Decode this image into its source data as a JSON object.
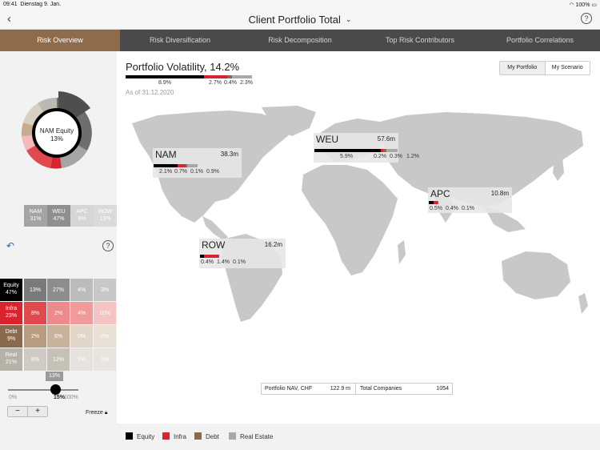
{
  "status_bar": {
    "time": "09:41",
    "date": "Dienstag 9. Jan.",
    "battery": "100%"
  },
  "header": {
    "title": "Client Portfolio Total"
  },
  "tabs": [
    {
      "label": "Risk Overview"
    },
    {
      "label": "Risk Diversification"
    },
    {
      "label": "Risk Decomposition"
    },
    {
      "label": "Top Risk Contributors"
    },
    {
      "label": "Portfolio Correlations"
    }
  ],
  "donut": {
    "center_label": "NAM Equity",
    "center_value": "13%"
  },
  "matrix": {
    "col_headers": [
      {
        "name": "NAM",
        "value": "31%"
      },
      {
        "name": "WEU",
        "value": "47%"
      },
      {
        "name": "APC",
        "value": "8%"
      },
      {
        "name": "ROW",
        "value": "13%"
      }
    ],
    "rows": [
      {
        "name": "Equity",
        "value": "47%",
        "cells": [
          "13%",
          "27%",
          "4%",
          "3%"
        ]
      },
      {
        "name": "Infra",
        "value": "23%",
        "cells": [
          "8%",
          "2%",
          "4%",
          "10%"
        ]
      },
      {
        "name": "Debt",
        "value": "9%",
        "cells": [
          "2%",
          "6%",
          "0%",
          "0%"
        ]
      },
      {
        "name": "Real",
        "value": "21%",
        "cells": [
          "8%",
          "12%",
          "1%",
          "1%"
        ]
      }
    ]
  },
  "slider": {
    "bubble": "13%",
    "min_label": "0%",
    "value_label": "15%",
    "max_label": "100%",
    "value_fraction": 0.15
  },
  "stepper": {
    "minus": "−",
    "plus": "+"
  },
  "freeze": {
    "label": "Freeze"
  },
  "portfolio": {
    "title": "Portfolio Volatility, 14.2%",
    "as_of": "As of 31.12.2020",
    "breakdown": [
      "8.9%",
      "2.7%",
      "0.4%",
      "2.3%"
    ]
  },
  "toggle": {
    "my_portfolio": "My Portfolio",
    "my_scenario": "My Scenario"
  },
  "regions": [
    {
      "name": "NAM",
      "value": "38.3m",
      "breakdown": [
        "2.1%",
        "0.7%",
        "0.1%",
        "0.9%"
      ]
    },
    {
      "name": "WEU",
      "value": "57.6m",
      "breakdown": [
        "5.9%",
        "0.2%",
        "0.3%",
        "1.2%"
      ]
    },
    {
      "name": "APC",
      "value": "10.8m",
      "breakdown": [
        "0.5%",
        "0.4%",
        "0.1%"
      ]
    },
    {
      "name": "ROW",
      "value": "16.2m",
      "breakdown": [
        "0.4%",
        "1.4%",
        "0.1%"
      ]
    }
  ],
  "summary": {
    "nav_label": "Portfolio NAV, CHF",
    "nav_value": "122.9 m",
    "companies_label": "Total Companies",
    "companies_value": "1054"
  },
  "legend": [
    {
      "label": "Equity",
      "color": "#000000"
    },
    {
      "label": "Infra",
      "color": "#d9232e"
    },
    {
      "label": "Debt",
      "color": "#8a6a4c"
    },
    {
      "label": "Real Estate",
      "color": "#a8a8a8"
    }
  ],
  "colors": {
    "accent": "#8e6c4b",
    "equity": "#000000",
    "infra": "#d9232e",
    "debt": "#8a6a4c",
    "real_estate": "#a8a8a8"
  }
}
